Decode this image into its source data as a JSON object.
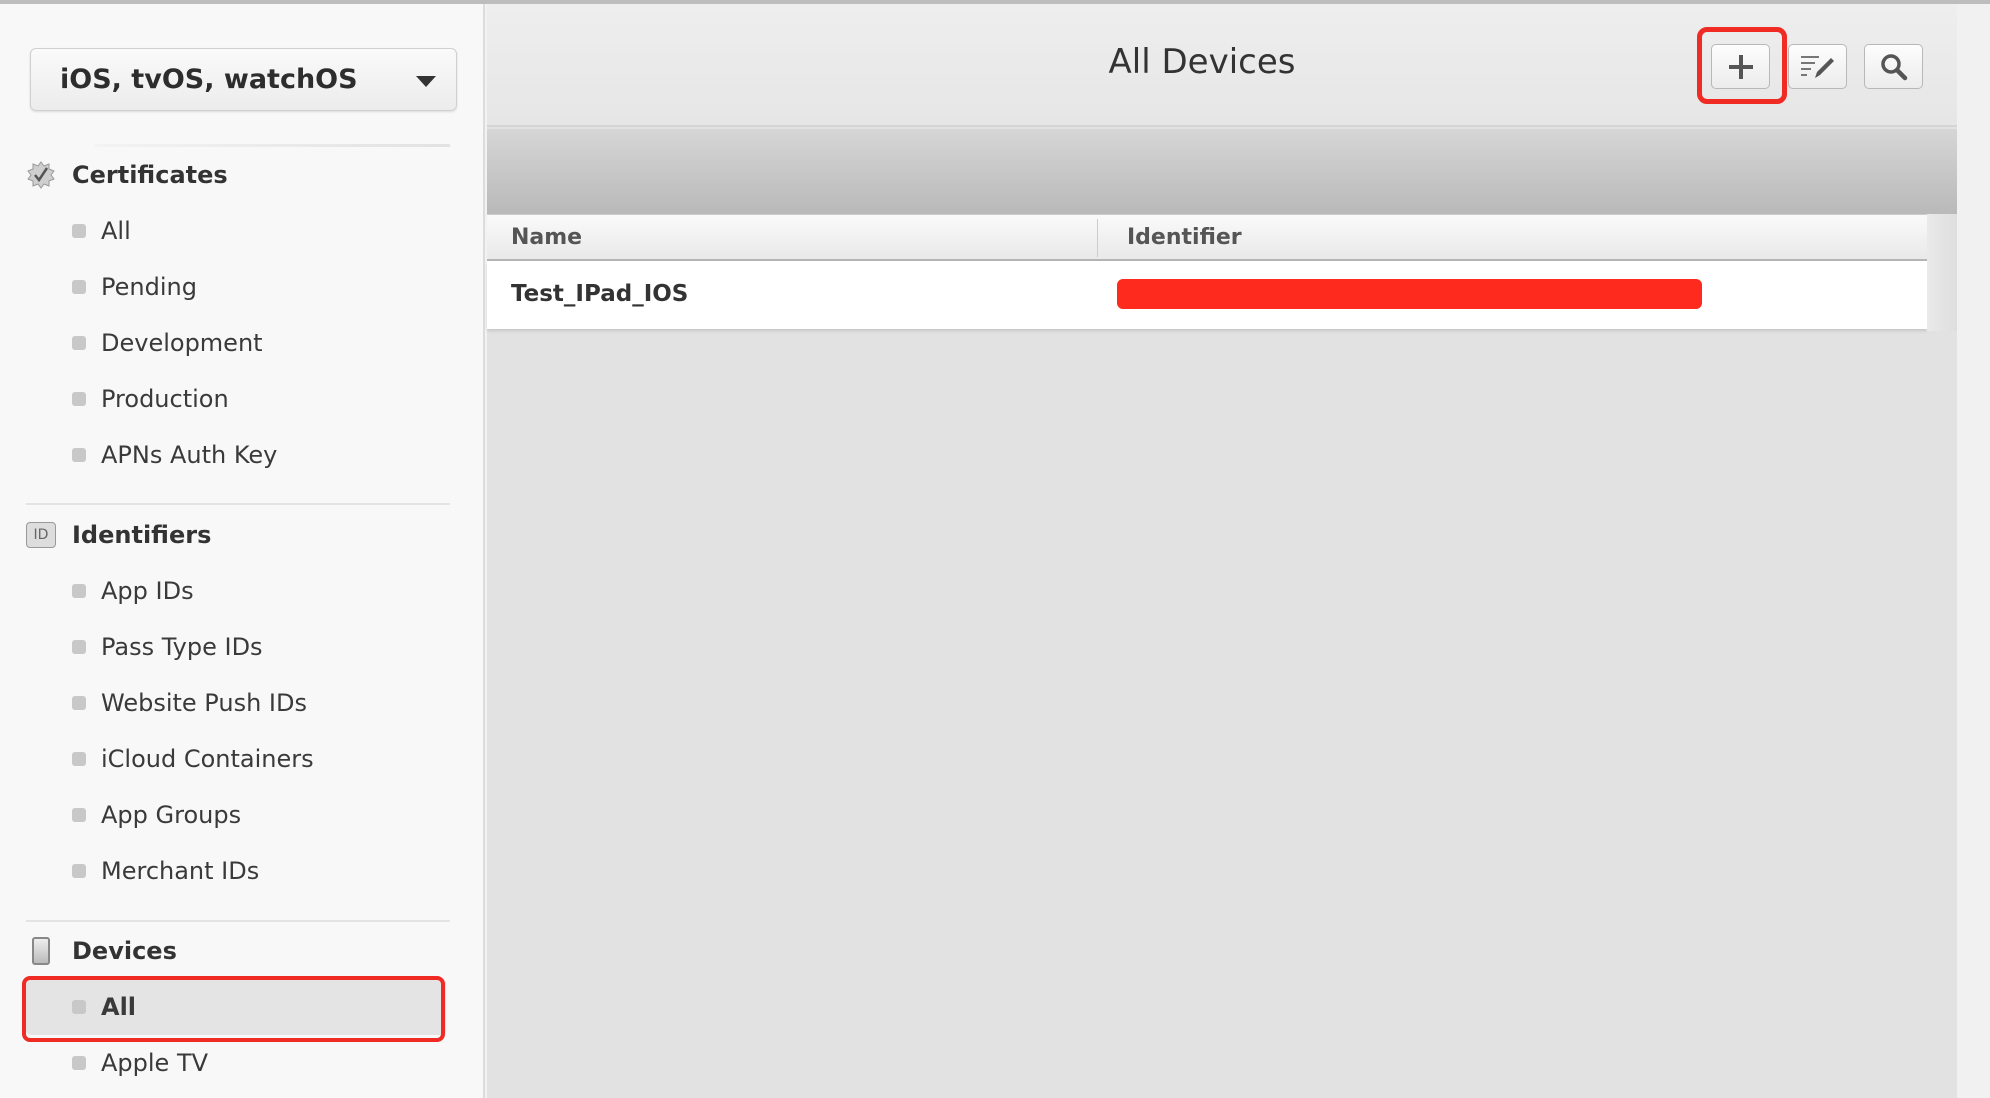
{
  "platform_selector": {
    "value": "iOS, tvOS, watchOS"
  },
  "sidebar": {
    "sections": [
      {
        "label": "Certificates",
        "icon": "certificate-badge-icon",
        "items": [
          "All",
          "Pending",
          "Development",
          "Production",
          "APNs Auth Key"
        ]
      },
      {
        "label": "Identifiers",
        "icon": "id-icon",
        "icon_text": "ID",
        "items": [
          "App IDs",
          "Pass Type IDs",
          "Website Push IDs",
          "iCloud Containers",
          "App Groups",
          "Merchant IDs"
        ]
      },
      {
        "label": "Devices",
        "icon": "device-icon",
        "items": [
          "All",
          "Apple TV"
        ]
      }
    ],
    "selected": "Devices / All"
  },
  "header": {
    "title": "All Devices",
    "buttons": [
      {
        "name": "add",
        "icon": "plus-icon"
      },
      {
        "name": "edit",
        "icon": "edit-list-icon"
      },
      {
        "name": "search",
        "icon": "search-icon"
      }
    ]
  },
  "table": {
    "columns": [
      "Name",
      "Identifier"
    ],
    "rows": [
      {
        "name": "Test_IPad_IOS",
        "identifier": "[redacted]"
      }
    ]
  },
  "colors": {
    "highlight": "#ef2b24",
    "redaction": "#ff2a1e"
  }
}
